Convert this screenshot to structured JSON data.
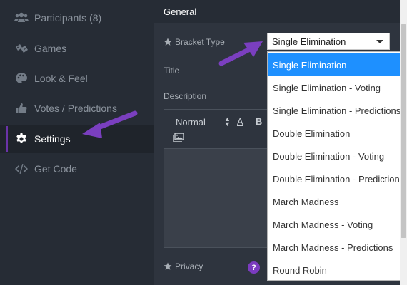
{
  "sidebar": {
    "items": [
      {
        "label": "Participants (8)",
        "icon": "users-icon"
      },
      {
        "label": "Games",
        "icon": "gamepad-icon"
      },
      {
        "label": "Look & Feel",
        "icon": "palette-icon"
      },
      {
        "label": "Votes / Predictions",
        "icon": "thumbs-up-icon"
      },
      {
        "label": "Settings",
        "icon": "gear-icon"
      },
      {
        "label": "Get Code",
        "icon": "code-icon"
      }
    ],
    "active_index": 4
  },
  "main": {
    "section_title": "General",
    "bracket_type_label": "Bracket Type",
    "title_label": "Title",
    "description_label": "Description",
    "privacy_label": "Privacy",
    "help_badge": "?",
    "editor": {
      "format_select": "Normal",
      "font_button": "A",
      "bold_button": "B"
    },
    "bracket_type_select": {
      "value": "Single Elimination",
      "options": [
        "Single Elimination",
        "Single Elimination - Voting",
        "Single Elimination - Predictions",
        "Double Elimination",
        "Double Elimination - Voting",
        "Double Elimination - Predictions",
        "March Madness",
        "March Madness - Voting",
        "March Madness - Predictions",
        "Round Robin"
      ],
      "highlighted_index": 0
    }
  },
  "colors": {
    "sidebar_bg": "#262c35",
    "main_bg": "#2e343e",
    "accent_purple": "#6a33a8",
    "selected_option": "#1e90ff"
  }
}
